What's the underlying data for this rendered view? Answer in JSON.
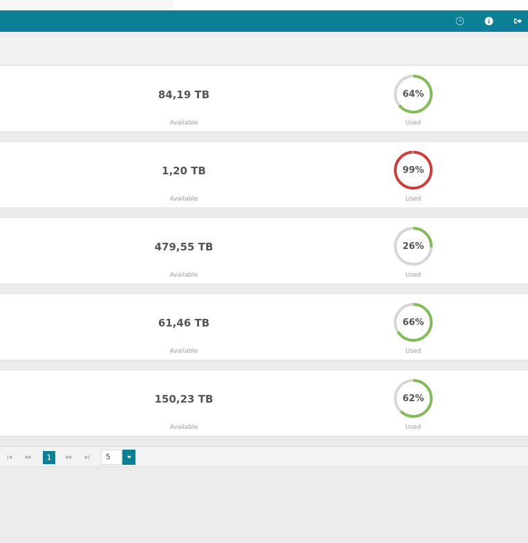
{
  "header": {
    "icons": [
      "pie-chart-icon",
      "info-icon",
      "logout-icon"
    ],
    "accent_color": "#0b7f93"
  },
  "storage": {
    "rows": [
      {
        "available_value": "84,19 TB",
        "available_label": "Available",
        "used_pct": 64,
        "used_pct_label": "64%",
        "used_label": "Used",
        "ring_color": "#82bb57"
      },
      {
        "available_value": "1,20 TB",
        "available_label": "Available",
        "used_pct": 99,
        "used_pct_label": "99%",
        "used_label": "Used",
        "ring_color": "#d33b36"
      },
      {
        "available_value": "479,55 TB",
        "available_label": "Available",
        "used_pct": 26,
        "used_pct_label": "26%",
        "used_label": "Used",
        "ring_color": "#82bb57"
      },
      {
        "available_value": "61,46 TB",
        "available_label": "Available",
        "used_pct": 66,
        "used_pct_label": "66%",
        "used_label": "Used",
        "ring_color": "#82bb57"
      },
      {
        "available_value": "150,23 TB",
        "available_label": "Available",
        "used_pct": 62,
        "used_pct_label": "62%",
        "used_label": "Used",
        "ring_color": "#82bb57"
      }
    ]
  },
  "pager": {
    "current_page": "1",
    "page_size": "5"
  }
}
